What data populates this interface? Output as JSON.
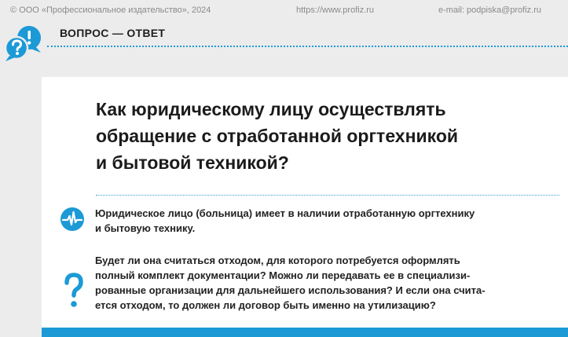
{
  "header": {
    "copyright": "© ООО «Профессиональное издательство», 2024",
    "url": "https://www.profiz.ru",
    "email": "e-mail: podpiska@profiz.ru"
  },
  "section": {
    "title": "ВОПРОС — ОТВЕТ",
    "icon": "chat-bubbles-icon"
  },
  "question": {
    "title_lines": [
      "Как юридическому лицу осуществлять",
      "обращение с отработанной оргтехникой",
      "и бытовой техникой?"
    ],
    "paragraph1": [
      "Юридическое лицо (больница) имеет в наличии отработанную оргтехнику",
      "и бытовую технику."
    ],
    "paragraph2": [
      "Будет ли она считаться отходом, для которого потребуется оформлять",
      "полный комплект документации? Можно ли передавать ее в специализи-",
      "рованные организации для дальнейшего использования? И если она счита-",
      "ется отходом, то должен ли договор быть именно на утилизацию?"
    ]
  },
  "colors": {
    "accent": "#1c9ad6",
    "text": "#1a1a1a",
    "background": "#ececec",
    "card": "#ffffff"
  }
}
